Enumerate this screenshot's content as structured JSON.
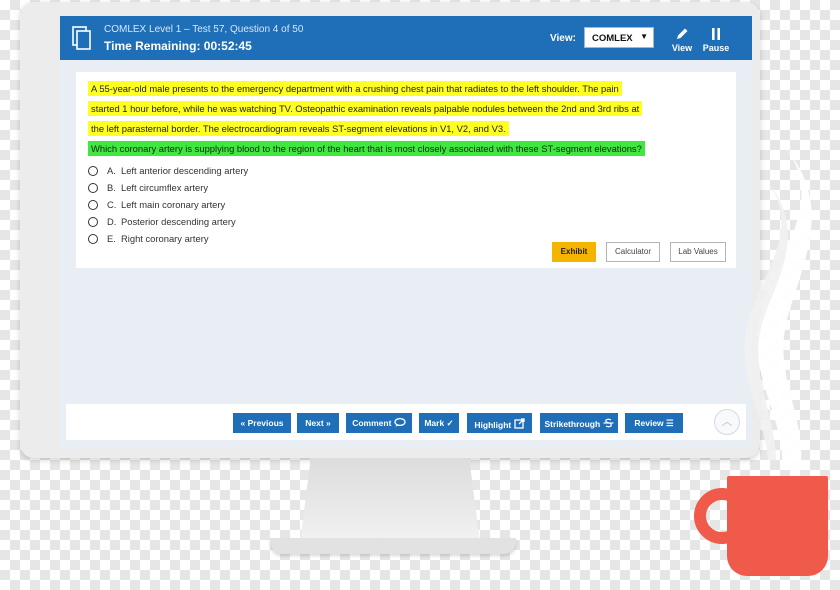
{
  "header": {
    "subtitle": "COMLEX Level 1 – Test 57, Question 4 of 50",
    "timer": "Time Remaining: 00:52:45",
    "view_label": "View:",
    "view_value": "COMLEX",
    "view_button": "View",
    "pause_button": "Pause"
  },
  "question": {
    "stem_lines": [
      "A 55-year-old male presents to the emergency department with a crushing chest pain that radiates to the left shoulder. The pain",
      "started 1 hour before, while he was watching TV. Osteopathic examination reveals palpable nodules between the 2nd and 3rd ribs at",
      "the left parasternal border. The electrocardiogram reveals ST-segment elevations in V1, V2, and V3.",
      "Which coronary artery is supplying blood to the region of the heart that is most closely associated with these ST-segment elevations?"
    ],
    "choices": [
      {
        "letter": "A.",
        "text": "Left anterior descending artery"
      },
      {
        "letter": "B.",
        "text": "Left circumflex artery"
      },
      {
        "letter": "C.",
        "text": "Left main coronary artery"
      },
      {
        "letter": "D.",
        "text": "Posterior descending artery"
      },
      {
        "letter": "E.",
        "text": "Right coronary artery"
      }
    ],
    "exhibit_label": "Exhibit",
    "calculator_label": "Calculator",
    "lab_values_label": "Lab Values"
  },
  "footer": {
    "previous": "« Previous",
    "next": "Next »",
    "comment": "Comment",
    "mark": "Mark ✓",
    "highlight": "Highlight",
    "strikethrough": "Strikethrough",
    "review": "Review ☰"
  },
  "colors": {
    "primary": "#1f6fb8",
    "highlight_yellow": "#ffff22",
    "highlight_green": "#3ee83e",
    "exhibit": "#f5b400",
    "mug": "#ef5a4a"
  }
}
